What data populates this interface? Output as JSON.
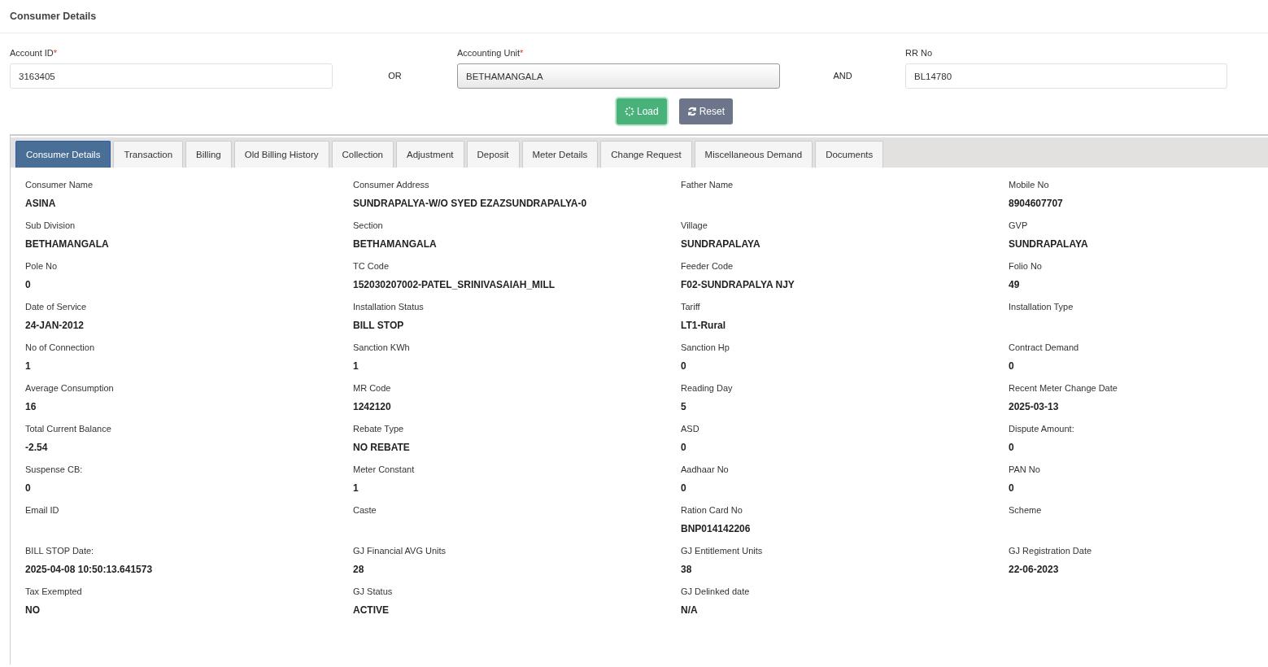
{
  "page_title": "Consumer Details",
  "search_form": {
    "fields": [
      {
        "label": "Account ID",
        "required_mark": "*",
        "value": "3163405",
        "kind": "text"
      },
      {
        "label": "Accounting Unit",
        "required_mark": "*",
        "value": "BETHAMANGALA",
        "kind": "select"
      },
      {
        "label": "RR No",
        "value": "BL14780",
        "kind": "text"
      }
    ],
    "connectors": [
      "OR",
      "AND"
    ],
    "buttons": [
      {
        "label": "Load",
        "kind": "load"
      },
      {
        "label": "Reset",
        "kind": "reset"
      }
    ]
  },
  "tabs": [
    {
      "label": "Consumer Details",
      "selected": true
    },
    {
      "label": "Transaction",
      "selected": false
    },
    {
      "label": "Billing",
      "selected": false
    },
    {
      "label": "Old Billing History",
      "selected": false
    },
    {
      "label": "Collection",
      "selected": false
    },
    {
      "label": "Adjustment",
      "selected": false
    },
    {
      "label": "Deposit",
      "selected": false
    },
    {
      "label": "Meter Details",
      "selected": false
    },
    {
      "label": "Change Request",
      "selected": false
    },
    {
      "label": "Miscellaneous Demand",
      "selected": false
    },
    {
      "label": "Documents",
      "selected": false
    }
  ],
  "details": [
    {
      "label": "Consumer Name",
      "value": "ASINA"
    },
    {
      "label": "Consumer Address",
      "value": "SUNDRAPALYA-W/O SYED EZAZSUNDRAPALYA-0"
    },
    {
      "label": "Father Name"
    },
    {
      "label": "Mobile No",
      "value": "8904607707"
    },
    {
      "label": "Sub Division",
      "value": "BETHAMANGALA"
    },
    {
      "label": "Section",
      "value": "BETHAMANGALA"
    },
    {
      "label": "Village",
      "value": "SUNDRAPALAYA"
    },
    {
      "label": "GVP",
      "value": "SUNDRAPALAYA"
    },
    {
      "label": "Pole No",
      "value": "0"
    },
    {
      "label": "TC Code",
      "value": "152030207002-PATEL_SRINIVASAIAH_MILL"
    },
    {
      "label": "Feeder Code",
      "value": "F02-SUNDRAPALYA NJY"
    },
    {
      "label": "Folio No",
      "value": "49"
    },
    {
      "label": "Date of Service",
      "value": "24-JAN-2012"
    },
    {
      "label": "Installation Status",
      "value": "BILL STOP"
    },
    {
      "label": "Tariff",
      "value": "LT1-Rural"
    },
    {
      "label": "Installation Type"
    },
    {
      "label": "No of Connection",
      "value": "1"
    },
    {
      "label": "Sanction KWh",
      "value": "1"
    },
    {
      "label": "Sanction Hp",
      "value": "0"
    },
    {
      "label": "Contract Demand",
      "value": "0"
    },
    {
      "label": "Average Consumption",
      "value": "16"
    },
    {
      "label": "MR Code",
      "value": "1242120"
    },
    {
      "label": "Reading Day",
      "value": "5"
    },
    {
      "label": "Recent Meter Change Date",
      "value": "2025-03-13"
    },
    {
      "label": "Total Current Balance",
      "value": "-2.54"
    },
    {
      "label": "Rebate Type",
      "value": "NO REBATE"
    },
    {
      "label": "ASD",
      "value": "0"
    },
    {
      "label": "Dispute Amount:",
      "value": "0"
    },
    {
      "label": "Suspense CB:",
      "value": "0"
    },
    {
      "label": "Meter Constant",
      "value": "1"
    },
    {
      "label": "Aadhaar No",
      "value": "0"
    },
    {
      "label": "PAN No",
      "value": "0"
    },
    {
      "label": "Email ID"
    },
    {
      "label": "Caste"
    },
    {
      "label": "Ration Card No",
      "value": "BNP014142206"
    },
    {
      "label": "Scheme"
    },
    {
      "label": "BILL STOP Date:",
      "value": "2025-04-08 10:50:13.641573"
    },
    {
      "label": "GJ Financial AVG Units",
      "value": "28"
    },
    {
      "label": "GJ Entitlement Units",
      "value": "38"
    },
    {
      "label": "GJ Registration Date",
      "value": "22-06-2023"
    },
    {
      "label": "Tax Exempted",
      "value": "NO"
    },
    {
      "label": "GJ Status",
      "value": "ACTIVE"
    },
    {
      "label": "GJ Delinked date",
      "value": "N/A"
    }
  ]
}
